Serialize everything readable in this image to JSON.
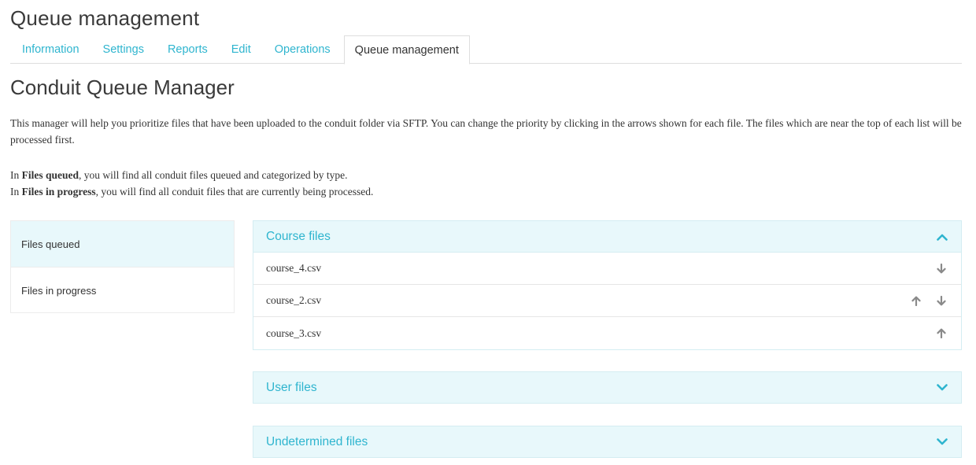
{
  "page": {
    "title": "Queue management"
  },
  "tabs": [
    {
      "label": "Information",
      "active": false
    },
    {
      "label": "Settings",
      "active": false
    },
    {
      "label": "Reports",
      "active": false
    },
    {
      "label": "Edit",
      "active": false
    },
    {
      "label": "Operations",
      "active": false
    },
    {
      "label": "Queue management",
      "active": true
    }
  ],
  "section": {
    "title": "Conduit Queue Manager"
  },
  "description": {
    "paragraph1": "This manager will help you prioritize files that have been uploaded to the conduit folder via SFTP. You can change the priority by clicking in the arrows shown for each file. The files which are near the top of each list will be processed first.",
    "line1_prefix": "In ",
    "line1_bold": "Files queued",
    "line1_suffix": ", you will find all conduit files queued and categorized by type.",
    "line2_prefix": "In ",
    "line2_bold": "Files in progress",
    "line2_suffix": ", you will find all conduit files that are currently being processed."
  },
  "side_nav": {
    "items": [
      {
        "label": "Files queued",
        "active": true
      },
      {
        "label": "Files in progress",
        "active": false
      }
    ]
  },
  "panels": {
    "course": {
      "title": "Course files",
      "expanded": true,
      "chevron_icon": "chevron-up-icon",
      "files": [
        {
          "name": "course_4.csv",
          "up": false,
          "down": true
        },
        {
          "name": "course_2.csv",
          "up": true,
          "down": true
        },
        {
          "name": "course_3.csv",
          "up": true,
          "down": false
        }
      ]
    },
    "user": {
      "title": "User files",
      "expanded": false,
      "chevron_icon": "chevron-down-icon"
    },
    "undetermined": {
      "title": "Undetermined files",
      "expanded": false,
      "chevron_icon": "chevron-down-icon"
    }
  },
  "colors": {
    "accent": "#2fb5cf",
    "panel_header_bg": "#e8f8fb",
    "arrow": "#8a8a8a"
  }
}
